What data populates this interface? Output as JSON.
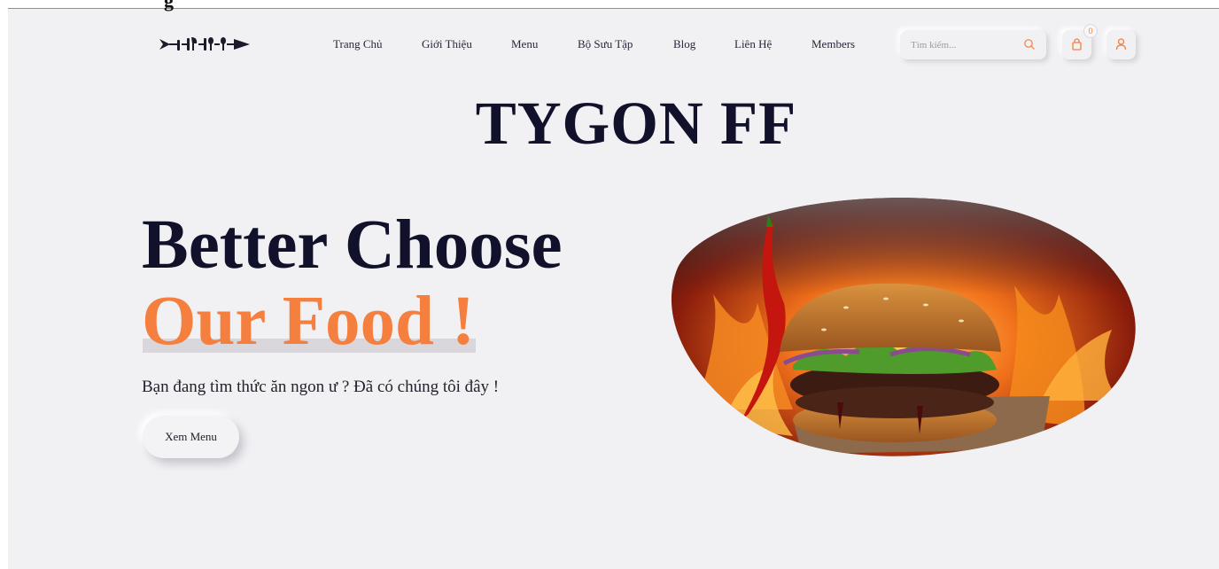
{
  "header": {
    "nav_items": [
      "Trang Chủ",
      "Giới Thiệu",
      "Menu",
      "Bộ Sưu Tập",
      "Blog",
      "Liên Hệ",
      "Members"
    ],
    "search_placeholder": "Tìm kiếm...",
    "cart_count": "0"
  },
  "brand": {
    "title": "TYGON FF"
  },
  "hero": {
    "line1": "Better Choose",
    "line2": "Our Food !",
    "subtitle": "Bạn đang tìm thức ăn ngon ư ? Đã có chúng tôi đây !",
    "cta_label": "Xem Menu"
  },
  "icons": {
    "logo": "fork-knife-logo-icon",
    "search": "search-icon",
    "cart": "shopping-bag-icon",
    "user": "user-icon"
  },
  "colors": {
    "accent": "#f57f3e",
    "dark": "#11112b",
    "background": "#f1f1f4"
  }
}
